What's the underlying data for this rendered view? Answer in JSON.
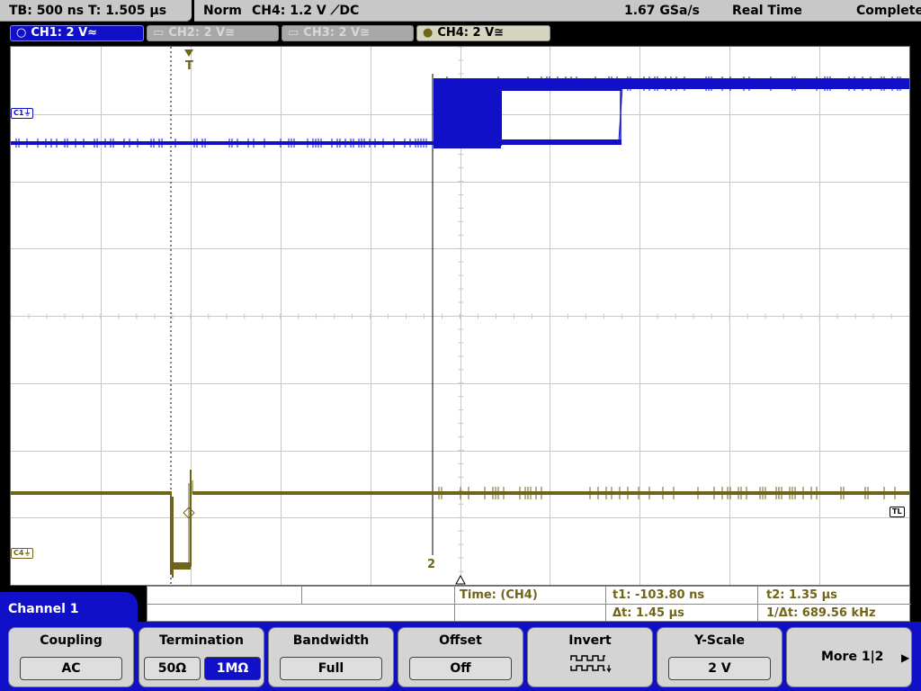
{
  "status_bar": {
    "timebase": "TB: 500 ns",
    "trigger_position": "T: 1.505 µs",
    "trigger_mode": "Norm",
    "trigger_setting": "CH4: 1.2 V ⟋DC",
    "sample_rate": "1.67 GSa/s",
    "acquisition_mode": "Real Time",
    "acquisition_status": "Complete"
  },
  "channels": [
    {
      "label": "CH1: 2 V",
      "coupling_symbol": "≈",
      "color": "#1010c8",
      "active": true
    },
    {
      "label": "CH2: 2 V",
      "coupling_symbol": "≅",
      "color": "#a8a8a8",
      "active": false
    },
    {
      "label": "CH3: 2 V",
      "coupling_symbol": "≅",
      "color": "#a8a8a8",
      "active": false
    },
    {
      "label": "CH4: 2 V",
      "coupling_symbol": "≅",
      "color": "#706418",
      "active": true
    }
  ],
  "markers": {
    "trigger": "T",
    "ch1_ground": "C1",
    "ch4_ground": "C4",
    "trigger_level": "TL",
    "cursor_2": "2"
  },
  "measurements": {
    "time_source": "Time:  (CH4)",
    "t1": "t1: -103.80 ns",
    "t2": "t2: 1.35 µs",
    "delta_t": "Δt: 1.45 µs",
    "inv_delta_t": "1/Δt: 689.56 kHz"
  },
  "menu": {
    "title": "Channel 1",
    "softkeys": [
      {
        "label": "Coupling",
        "value": "AC"
      },
      {
        "label": "Termination",
        "options": [
          "50Ω",
          "1MΩ"
        ],
        "selected": "1MΩ"
      },
      {
        "label": "Bandwidth",
        "value": "Full"
      },
      {
        "label": "Offset",
        "value": "Off"
      },
      {
        "label": "Invert"
      },
      {
        "label": "Y-Scale",
        "value": "2 V"
      },
      {
        "label": "More 1|2"
      }
    ]
  },
  "colors": {
    "ch1": "#1010c8",
    "ch4": "#706418",
    "graticule": "#c8c8c8"
  }
}
